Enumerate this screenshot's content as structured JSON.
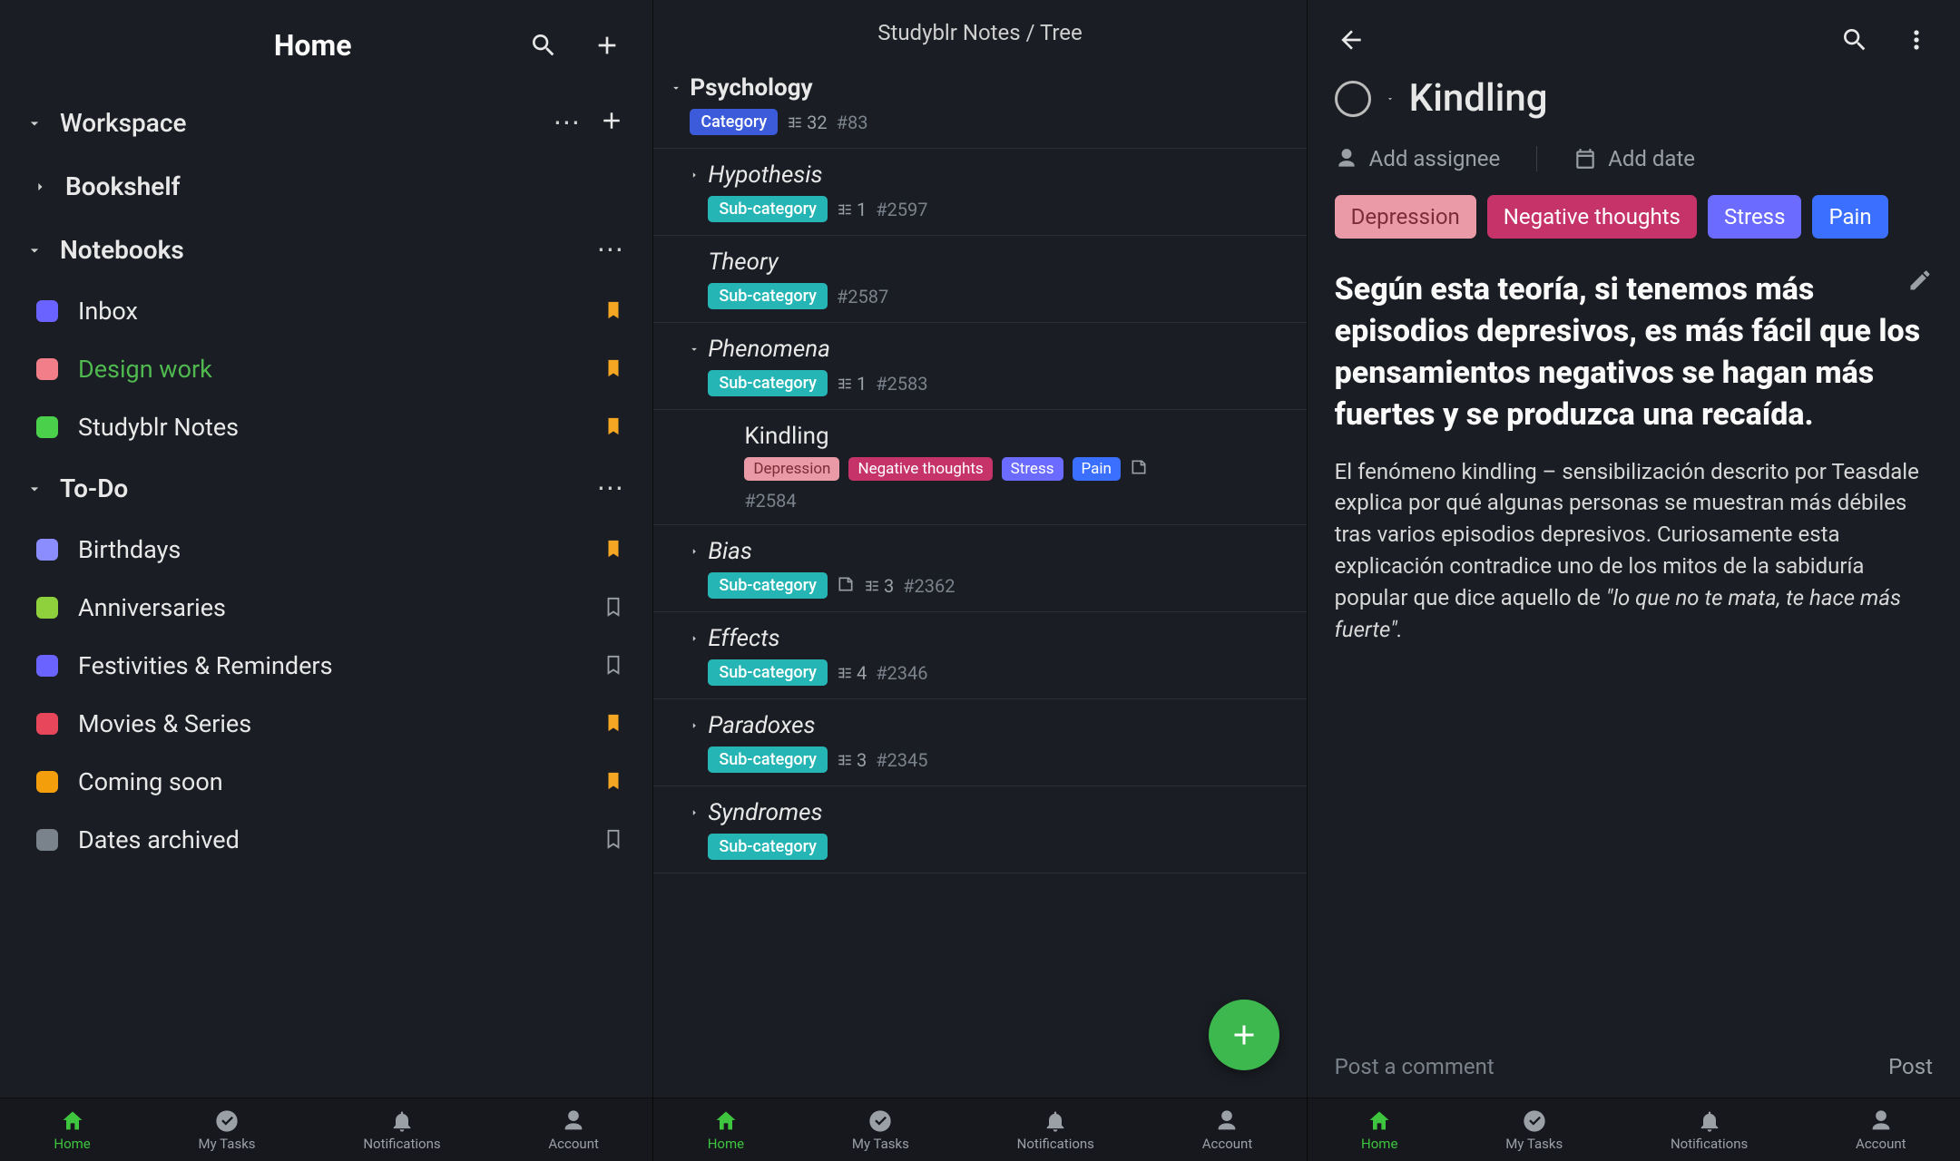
{
  "pane1": {
    "title": "Home",
    "workspace_label": "Workspace",
    "bookshelf_label": "Bookshelf",
    "notebooks_label": "Notebooks",
    "todo_label": "To-Do",
    "notebooks": [
      {
        "label": "Inbox",
        "color": "#6b63ff",
        "bookmarked": true
      },
      {
        "label": "Design work",
        "color": "#f27e8a",
        "bookmarked": true,
        "active": true
      },
      {
        "label": "Studyblr Notes",
        "color": "#4bd04b",
        "bookmarked": true
      }
    ],
    "todos": [
      {
        "label": "Birthdays",
        "color": "#8b8dff",
        "bookmarked": true
      },
      {
        "label": "Anniversaries",
        "color": "#8ed13d",
        "bookmarked": false
      },
      {
        "label": "Festivities & Reminders",
        "color": "#6b63ff",
        "bookmarked": false
      },
      {
        "label": "Movies & Series",
        "color": "#e8465a",
        "bookmarked": true
      },
      {
        "label": "Coming soon",
        "color": "#f59e0b",
        "bookmarked": true
      },
      {
        "label": "Dates archived",
        "color": "#7a828c",
        "bookmarked": false
      }
    ]
  },
  "pane2": {
    "breadcrumb": "Studyblr Notes / Tree",
    "root": {
      "title": "Psychology",
      "chip": "Category",
      "children_count": "32",
      "hash": "#83"
    },
    "nodes": [
      {
        "title": "Hypothesis",
        "chip": "Sub-category",
        "children_count": "1",
        "hash": "#2597",
        "caret": "right"
      },
      {
        "title": "Theory",
        "chip": "Sub-category",
        "hash": "#2587",
        "caret": "none"
      },
      {
        "title": "Phenomena",
        "chip": "Sub-category",
        "children_count": "1",
        "hash": "#2583",
        "caret": "down",
        "child": {
          "title": "Kindling",
          "tags": [
            {
              "label": "Depression",
              "bg": "#e99aa6",
              "fg": "#782d37"
            },
            {
              "label": "Negative thoughts",
              "bg": "#c53368",
              "fg": "#fff"
            },
            {
              "label": "Stress",
              "bg": "#6b6cff",
              "fg": "#fff"
            },
            {
              "label": "Pain",
              "bg": "#3b6fff",
              "fg": "#fff"
            }
          ],
          "note_icon": true,
          "hash": "#2584"
        }
      },
      {
        "title": "Bias",
        "chip": "Sub-category",
        "note_count": "",
        "children_count": "3",
        "hash": "#2362",
        "caret": "right",
        "has_note_icon": true
      },
      {
        "title": "Effects",
        "chip": "Sub-category",
        "children_count": "4",
        "hash": "#2346",
        "caret": "right"
      },
      {
        "title": "Paradoxes",
        "chip": "Sub-category",
        "children_count": "3",
        "hash": "#2345",
        "caret": "right"
      },
      {
        "title": "Syndromes",
        "chip": "Sub-category",
        "caret": "right"
      }
    ]
  },
  "pane3": {
    "title": "Kindling",
    "add_assignee": "Add assignee",
    "add_date": "Add date",
    "tags": [
      {
        "label": "Depression",
        "bg": "#e99aa6",
        "fg": "#782d37"
      },
      {
        "label": "Negative thoughts",
        "bg": "#c53368",
        "fg": "#fff"
      },
      {
        "label": "Stress",
        "bg": "#6b6cff",
        "fg": "#fff"
      },
      {
        "label": "Pain",
        "bg": "#3b6fff",
        "fg": "#fff"
      }
    ],
    "heading": "Según esta teoría, si tenemos más episodios depresivos, es más fácil que los pensamientos negativos se hagan más fuertes y se produzca una recaída.",
    "body_plain": "El fenómeno kindling – sensibilización descrito por Teasdale explica por qué algunas personas se muestran más débiles tras varios episodios depresivos. Curiosamente esta explicación contradice uno de los mitos de la sabiduría popular que dice aquello de ",
    "body_quote": "\"lo que no te mata, te hace más fuerte\".",
    "comment_placeholder": "Post a comment",
    "post_label": "Post"
  },
  "nav": {
    "home": "Home",
    "mytasks": "My Tasks",
    "notifications": "Notifications",
    "account": "Account"
  }
}
